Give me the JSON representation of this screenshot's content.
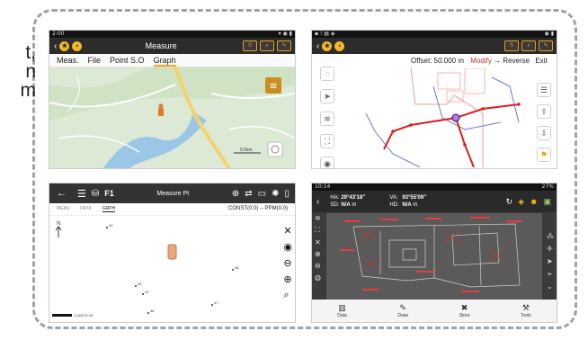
{
  "side_text": [
    "t,",
    "n",
    "m"
  ],
  "panel1": {
    "status_time": "2:00",
    "title": "Measure",
    "tabs": [
      "Meas.",
      "File",
      "Point S.O",
      "Graph"
    ],
    "active_tab": "Graph",
    "scale_label": "0.5km"
  },
  "panel2": {
    "offset_label": "Offset:",
    "offset_value": "50.000",
    "offset_unit": "m",
    "modify_label": "Modify",
    "reverse_label": "Reverse",
    "exit_label": "Exit"
  },
  "panel3": {
    "title": "Measure Pt",
    "f_label": "F1",
    "tabs": [
      "MEAS",
      "DATA",
      "GRPH"
    ],
    "active_tab": "GRPH",
    "const_label": "CONST(0.0) -- PPM(0.0)",
    "north_label": "N",
    "scale_label": "1:183714 M",
    "point_labels": [
      "40",
      "48",
      "45",
      "42",
      "47",
      "48"
    ]
  },
  "panel4": {
    "status_time": "10:14",
    "battery": "27%",
    "ha_label": "HA:",
    "ha_value": "29°43'18\"",
    "va_label": "VA:",
    "va_value": "93°55'09\"",
    "sd_label": "SD:",
    "sd_value": "N/A",
    "sd_unit": "m",
    "hd_label": "HD:",
    "hd_value": "N/A",
    "hd_unit": "m",
    "bottom_tabs": [
      "Data",
      "Draw",
      "Store",
      "Tools"
    ]
  }
}
